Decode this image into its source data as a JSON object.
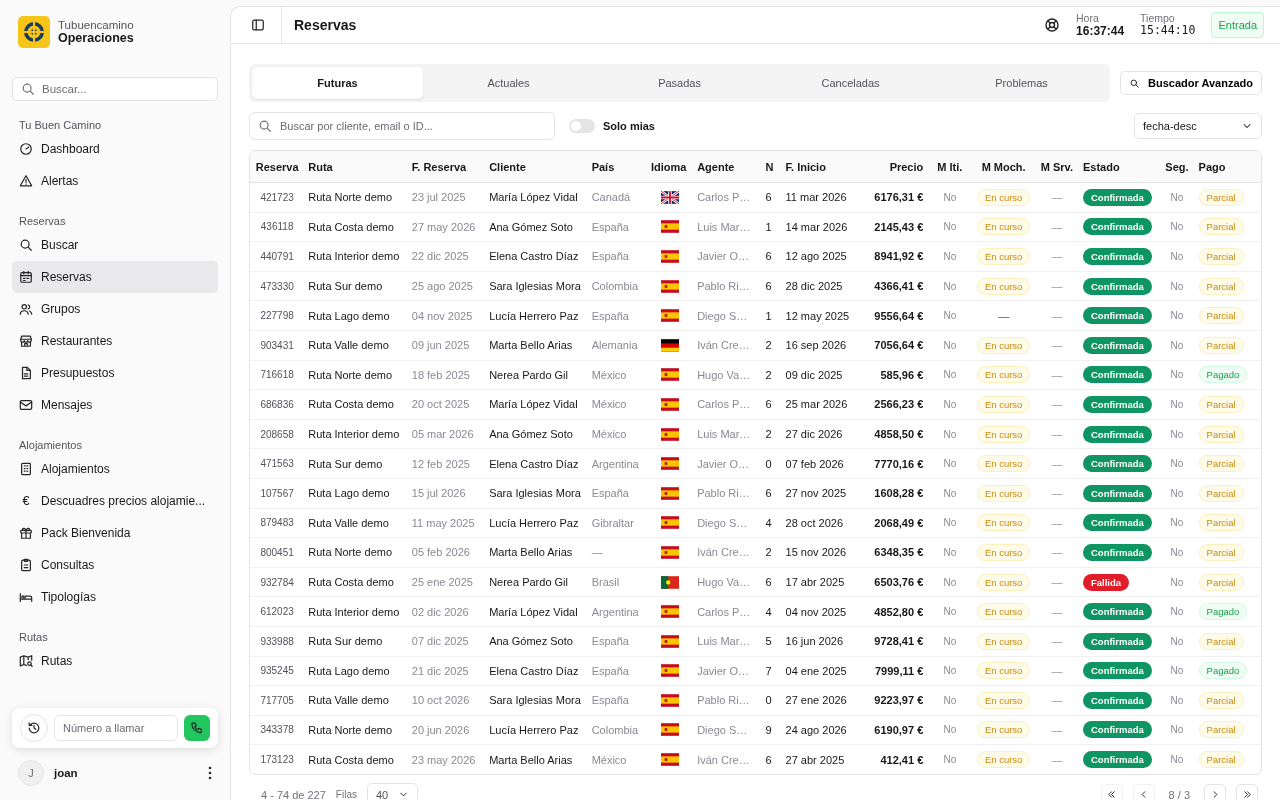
{
  "brand": {
    "name": "Tubuencamino",
    "subtitle": "Operaciones"
  },
  "sidebar": {
    "search_placeholder": "Buscar...",
    "sections": [
      {
        "title": "Tu Buen Camino",
        "items": [
          {
            "label": "Dashboard",
            "selected": false
          },
          {
            "label": "Alertas",
            "selected": false
          }
        ]
      },
      {
        "title": "Reservas",
        "items": [
          {
            "label": "Buscar",
            "selected": false
          },
          {
            "label": "Reservas",
            "selected": true
          },
          {
            "label": "Grupos",
            "selected": false
          },
          {
            "label": "Restaurantes",
            "selected": false
          },
          {
            "label": "Presupuestos",
            "selected": false
          },
          {
            "label": "Mensajes",
            "selected": false
          }
        ]
      },
      {
        "title": "Alojamientos",
        "items": [
          {
            "label": "Alojamientos",
            "selected": false
          },
          {
            "label": "Descuadres precios alojamie...",
            "icon_text": "€",
            "selected": false
          },
          {
            "label": "Pack Bienvenida",
            "selected": false
          },
          {
            "label": "Consultas",
            "selected": false
          },
          {
            "label": "Tipologías",
            "selected": false
          }
        ]
      },
      {
        "title": "Rutas",
        "items": [
          {
            "label": "Rutas",
            "selected": false
          }
        ]
      }
    ]
  },
  "call_widget": {
    "placeholder": "Número a llamar"
  },
  "user": {
    "initial": "J",
    "name": "joan"
  },
  "header": {
    "title": "Reservas",
    "clocks": [
      {
        "label": "Hora",
        "value": "16:37:44"
      },
      {
        "label": "Tiempo",
        "value": "15:44:10"
      }
    ],
    "status_button": "Entrada"
  },
  "tabs": [
    {
      "label": "Futuras",
      "selected": true
    },
    {
      "label": "Actuales",
      "selected": false
    },
    {
      "label": "Pasadas",
      "selected": false
    },
    {
      "label": "Canceladas",
      "selected": false
    },
    {
      "label": "Problemas",
      "selected": false
    }
  ],
  "advanced_search": "Buscador Avanzado",
  "search": {
    "placeholder": "Buscar por cliente, email o ID..."
  },
  "mine_toggle": {
    "label": "Solo mias",
    "on": false
  },
  "sort": {
    "value": "fecha-desc"
  },
  "table": {
    "columns": [
      "Reserva",
      "Ruta",
      "F. Reserva",
      "Cliente",
      "País",
      "Idioma",
      "Agente",
      "N",
      "F. Inicio",
      "Precio",
      "M Iti.",
      "M Moch.",
      "M Srv.",
      "Estado",
      "Seg.",
      "Pago"
    ],
    "rows": [
      {
        "reserva": "421723",
        "ruta": "Ruta Norte demo",
        "f_reserva": "23 jul 2025",
        "cliente": "María López Vidal",
        "pais": "Canadá",
        "idioma": {
          "kind": "gb"
        },
        "agente": "Carlos P…",
        "n": "6",
        "f_inicio": "11 mar 2026",
        "precio": "6176,31 €",
        "m_iti": "No",
        "m_moch": {
          "text": "En curso",
          "kind": "progress"
        },
        "m_srv": "—",
        "estado": {
          "text": "Confirmada",
          "kind": "ok"
        },
        "seg": "No",
        "pago": {
          "text": "Parcial",
          "kind": "partial"
        }
      },
      {
        "reserva": "436118",
        "ruta": "Ruta Costa demo",
        "f_reserva": "27 may 2026",
        "cliente": "Ana Gómez Soto",
        "pais": "España",
        "idioma": {
          "kind": "es"
        },
        "agente": "Luis Mar…",
        "n": "1",
        "f_inicio": "14 mar 2026",
        "precio": "2145,43 €",
        "m_iti": "No",
        "m_moch": {
          "text": "En curso",
          "kind": "progress"
        },
        "m_srv": "—",
        "estado": {
          "text": "Confirmada",
          "kind": "ok"
        },
        "seg": "No",
        "pago": {
          "text": "Parcial",
          "kind": "partial"
        }
      },
      {
        "reserva": "440791",
        "ruta": "Ruta Interior demo",
        "f_reserva": "22 dic 2025",
        "cliente": "Elena Castro Díaz",
        "pais": "España",
        "idioma": {
          "kind": "es"
        },
        "agente": "Javier O…",
        "n": "6",
        "f_inicio": "12 ago 2025",
        "precio": "8941,92 €",
        "m_iti": "No",
        "m_moch": {
          "text": "En curso",
          "kind": "progress"
        },
        "m_srv": "—",
        "estado": {
          "text": "Confirmada",
          "kind": "ok"
        },
        "seg": "No",
        "pago": {
          "text": "Parcial",
          "kind": "partial"
        }
      },
      {
        "reserva": "473330",
        "ruta": "Ruta Sur demo",
        "f_reserva": "25 ago 2025",
        "cliente": "Sara Iglesias Mora",
        "pais": "Colombia",
        "idioma": {
          "kind": "es"
        },
        "agente": "Pablo Ri…",
        "n": "6",
        "f_inicio": "28 dic 2025",
        "precio": "4366,41 €",
        "m_iti": "No",
        "m_moch": {
          "text": "En curso",
          "kind": "progress"
        },
        "m_srv": "—",
        "estado": {
          "text": "Confirmada",
          "kind": "ok"
        },
        "seg": "No",
        "pago": {
          "text": "Parcial",
          "kind": "partial"
        }
      },
      {
        "reserva": "227798",
        "ruta": "Ruta Lago demo",
        "f_reserva": "04 nov 2025",
        "cliente": "Lucía Herrero Paz",
        "pais": "España",
        "idioma": {
          "kind": "es"
        },
        "agente": "Diego S…",
        "n": "1",
        "f_inicio": "12 may 2025",
        "precio": "9556,64 €",
        "m_iti": "No",
        "m_moch": {
          "text": "—",
          "kind": "none"
        },
        "m_srv": "—",
        "estado": {
          "text": "Confirmada",
          "kind": "ok"
        },
        "seg": "No",
        "pago": {
          "text": "Parcial",
          "kind": "partial"
        }
      },
      {
        "reserva": "903431",
        "ruta": "Ruta Valle demo",
        "f_reserva": "09 jun 2025",
        "cliente": "Marta Bello Arias",
        "pais": "Alemania",
        "idioma": {
          "kind": "de"
        },
        "agente": "Iván Cre…",
        "n": "2",
        "f_inicio": "16 sep 2026",
        "precio": "7056,64 €",
        "m_iti": "No",
        "m_moch": {
          "text": "En curso",
          "kind": "progress"
        },
        "m_srv": "—",
        "estado": {
          "text": "Confirmada",
          "kind": "ok"
        },
        "seg": "No",
        "pago": {
          "text": "Parcial",
          "kind": "partial"
        }
      },
      {
        "reserva": "716618",
        "ruta": "Ruta Norte demo",
        "f_reserva": "18 feb 2025",
        "cliente": "Nerea Pardo Gil",
        "pais": "México",
        "idioma": {
          "kind": "es"
        },
        "agente": "Hugo Va…",
        "n": "2",
        "f_inicio": "09 dic 2025",
        "precio": "585,96 €",
        "m_iti": "No",
        "m_moch": {
          "text": "En curso",
          "kind": "progress"
        },
        "m_srv": "—",
        "estado": {
          "text": "Confirmada",
          "kind": "ok"
        },
        "seg": "No",
        "pago": {
          "text": "Pagado",
          "kind": "paid"
        }
      },
      {
        "reserva": "686836",
        "ruta": "Ruta Costa demo",
        "f_reserva": "20 oct 2025",
        "cliente": "María López Vidal",
        "pais": "México",
        "idioma": {
          "kind": "es"
        },
        "agente": "Carlos P…",
        "n": "6",
        "f_inicio": "25 mar 2026",
        "precio": "2566,23 €",
        "m_iti": "No",
        "m_moch": {
          "text": "En curso",
          "kind": "progress"
        },
        "m_srv": "—",
        "estado": {
          "text": "Confirmada",
          "kind": "ok"
        },
        "seg": "No",
        "pago": {
          "text": "Parcial",
          "kind": "partial"
        }
      },
      {
        "reserva": "208658",
        "ruta": "Ruta Interior demo",
        "f_reserva": "05 mar 2026",
        "cliente": "Ana Gómez Soto",
        "pais": "México",
        "idioma": {
          "kind": "es"
        },
        "agente": "Luis Mar…",
        "n": "2",
        "f_inicio": "27 dic 2026",
        "precio": "4858,50 €",
        "m_iti": "No",
        "m_moch": {
          "text": "En curso",
          "kind": "progress"
        },
        "m_srv": "—",
        "estado": {
          "text": "Confirmada",
          "kind": "ok"
        },
        "seg": "No",
        "pago": {
          "text": "Parcial",
          "kind": "partial"
        }
      },
      {
        "reserva": "471563",
        "ruta": "Ruta Sur demo",
        "f_reserva": "12 feb 2025",
        "cliente": "Elena Castro Díaz",
        "pais": "Argentina",
        "idioma": {
          "kind": "es"
        },
        "agente": "Javier O…",
        "n": "0",
        "f_inicio": "07 feb 2026",
        "precio": "7770,16 €",
        "m_iti": "No",
        "m_moch": {
          "text": "En curso",
          "kind": "progress"
        },
        "m_srv": "—",
        "estado": {
          "text": "Confirmada",
          "kind": "ok"
        },
        "seg": "No",
        "pago": {
          "text": "Parcial",
          "kind": "partial"
        }
      },
      {
        "reserva": "107567",
        "ruta": "Ruta Lago demo",
        "f_reserva": "15 jul 2026",
        "cliente": "Sara Iglesias Mora",
        "pais": "España",
        "idioma": {
          "kind": "es"
        },
        "agente": "Pablo Ri…",
        "n": "6",
        "f_inicio": "27 nov 2025",
        "precio": "1608,28 €",
        "m_iti": "No",
        "m_moch": {
          "text": "En curso",
          "kind": "progress"
        },
        "m_srv": "—",
        "estado": {
          "text": "Confirmada",
          "kind": "ok"
        },
        "seg": "No",
        "pago": {
          "text": "Parcial",
          "kind": "partial"
        }
      },
      {
        "reserva": "879483",
        "ruta": "Ruta Valle demo",
        "f_reserva": "11 may 2025",
        "cliente": "Lucía Herrero Paz",
        "pais": "Gibraltar",
        "idioma": {
          "kind": "es"
        },
        "agente": "Diego S…",
        "n": "4",
        "f_inicio": "28 oct 2026",
        "precio": "2068,49 €",
        "m_iti": "No",
        "m_moch": {
          "text": "En curso",
          "kind": "progress"
        },
        "m_srv": "—",
        "estado": {
          "text": "Confirmada",
          "kind": "ok"
        },
        "seg": "No",
        "pago": {
          "text": "Parcial",
          "kind": "partial"
        }
      },
      {
        "reserva": "800451",
        "ruta": "Ruta Norte demo",
        "f_reserva": "05 feb 2026",
        "cliente": "Marta Bello Arias",
        "pais": "—",
        "idioma": {
          "kind": "es"
        },
        "agente": "Iván Cre…",
        "n": "2",
        "f_inicio": "15 nov 2026",
        "precio": "6348,35 €",
        "m_iti": "No",
        "m_moch": {
          "text": "En curso",
          "kind": "progress"
        },
        "m_srv": "—",
        "estado": {
          "text": "Confirmada",
          "kind": "ok"
        },
        "seg": "No",
        "pago": {
          "text": "Parcial",
          "kind": "partial"
        }
      },
      {
        "reserva": "932784",
        "ruta": "Ruta Costa demo",
        "f_reserva": "25 ene 2025",
        "cliente": "Nerea Pardo Gil",
        "pais": "Brasil",
        "idioma": {
          "kind": "pt"
        },
        "agente": "Hugo Va…",
        "n": "6",
        "f_inicio": "17 abr 2025",
        "precio": "6503,76 €",
        "m_iti": "No",
        "m_moch": {
          "text": "En curso",
          "kind": "progress"
        },
        "m_srv": "—",
        "estado": {
          "text": "Fallida",
          "kind": "error"
        },
        "seg": "No",
        "pago": {
          "text": "Parcial",
          "kind": "partial"
        }
      },
      {
        "reserva": "612023",
        "ruta": "Ruta Interior demo",
        "f_reserva": "02 dic 2026",
        "cliente": "María López Vidal",
        "pais": "Argentina",
        "idioma": {
          "kind": "es"
        },
        "agente": "Carlos P…",
        "n": "4",
        "f_inicio": "04 nov 2025",
        "precio": "4852,80 €",
        "m_iti": "No",
        "m_moch": {
          "text": "En curso",
          "kind": "progress"
        },
        "m_srv": "—",
        "estado": {
          "text": "Confirmada",
          "kind": "ok"
        },
        "seg": "No",
        "pago": {
          "text": "Pagado",
          "kind": "paid"
        }
      },
      {
        "reserva": "933988",
        "ruta": "Ruta Sur demo",
        "f_reserva": "07 dic 2025",
        "cliente": "Ana Gómez Soto",
        "pais": "España",
        "idioma": {
          "kind": "es"
        },
        "agente": "Luis Mar…",
        "n": "5",
        "f_inicio": "16 jun 2026",
        "precio": "9728,41 €",
        "m_iti": "No",
        "m_moch": {
          "text": "En curso",
          "kind": "progress"
        },
        "m_srv": "—",
        "estado": {
          "text": "Confirmada",
          "kind": "ok"
        },
        "seg": "No",
        "pago": {
          "text": "Parcial",
          "kind": "partial"
        }
      },
      {
        "reserva": "935245",
        "ruta": "Ruta Lago demo",
        "f_reserva": "21 dic 2025",
        "cliente": "Elena Castro Díaz",
        "pais": "España",
        "idioma": {
          "kind": "es"
        },
        "agente": "Javier O…",
        "n": "7",
        "f_inicio": "04 ene 2025",
        "precio": "7999,11 €",
        "m_iti": "No",
        "m_moch": {
          "text": "En curso",
          "kind": "progress"
        },
        "m_srv": "—",
        "estado": {
          "text": "Confirmada",
          "kind": "ok"
        },
        "seg": "No",
        "pago": {
          "text": "Pagado",
          "kind": "paid"
        }
      },
      {
        "reserva": "717705",
        "ruta": "Ruta Valle demo",
        "f_reserva": "10 oct 2026",
        "cliente": "Sara Iglesias Mora",
        "pais": "España",
        "idioma": {
          "kind": "es"
        },
        "agente": "Pablo Ri…",
        "n": "0",
        "f_inicio": "27 ene 2026",
        "precio": "9223,97 €",
        "m_iti": "No",
        "m_moch": {
          "text": "En curso",
          "kind": "progress"
        },
        "m_srv": "—",
        "estado": {
          "text": "Confirmada",
          "kind": "ok"
        },
        "seg": "No",
        "pago": {
          "text": "Parcial",
          "kind": "partial"
        }
      },
      {
        "reserva": "343378",
        "ruta": "Ruta Norte demo",
        "f_reserva": "20 jun 2026",
        "cliente": "Lucía Herrero Paz",
        "pais": "Colombia",
        "idioma": {
          "kind": "es"
        },
        "agente": "Diego S…",
        "n": "9",
        "f_inicio": "24 ago 2026",
        "precio": "6190,97 €",
        "m_iti": "No",
        "m_moch": {
          "text": "En curso",
          "kind": "progress"
        },
        "m_srv": "—",
        "estado": {
          "text": "Confirmada",
          "kind": "ok"
        },
        "seg": "No",
        "pago": {
          "text": "Parcial",
          "kind": "partial"
        }
      },
      {
        "reserva": "173123",
        "ruta": "Ruta Costa demo",
        "f_reserva": "23 may 2026",
        "cliente": "Marta Bello Arias",
        "pais": "México",
        "idioma": {
          "kind": "es"
        },
        "agente": "Iván Cre…",
        "n": "6",
        "f_inicio": "27 abr 2025",
        "precio": "412,41 €",
        "m_iti": "No",
        "m_moch": {
          "text": "En curso",
          "kind": "progress"
        },
        "m_srv": "—",
        "estado": {
          "text": "Confirmada",
          "kind": "ok"
        },
        "seg": "No",
        "pago": {
          "text": "Parcial",
          "kind": "partial"
        }
      }
    ]
  },
  "footer": {
    "range": "4 - 74 de 227",
    "rows_label": "Filas",
    "rows_value": "40",
    "page": "8 / 3"
  }
}
